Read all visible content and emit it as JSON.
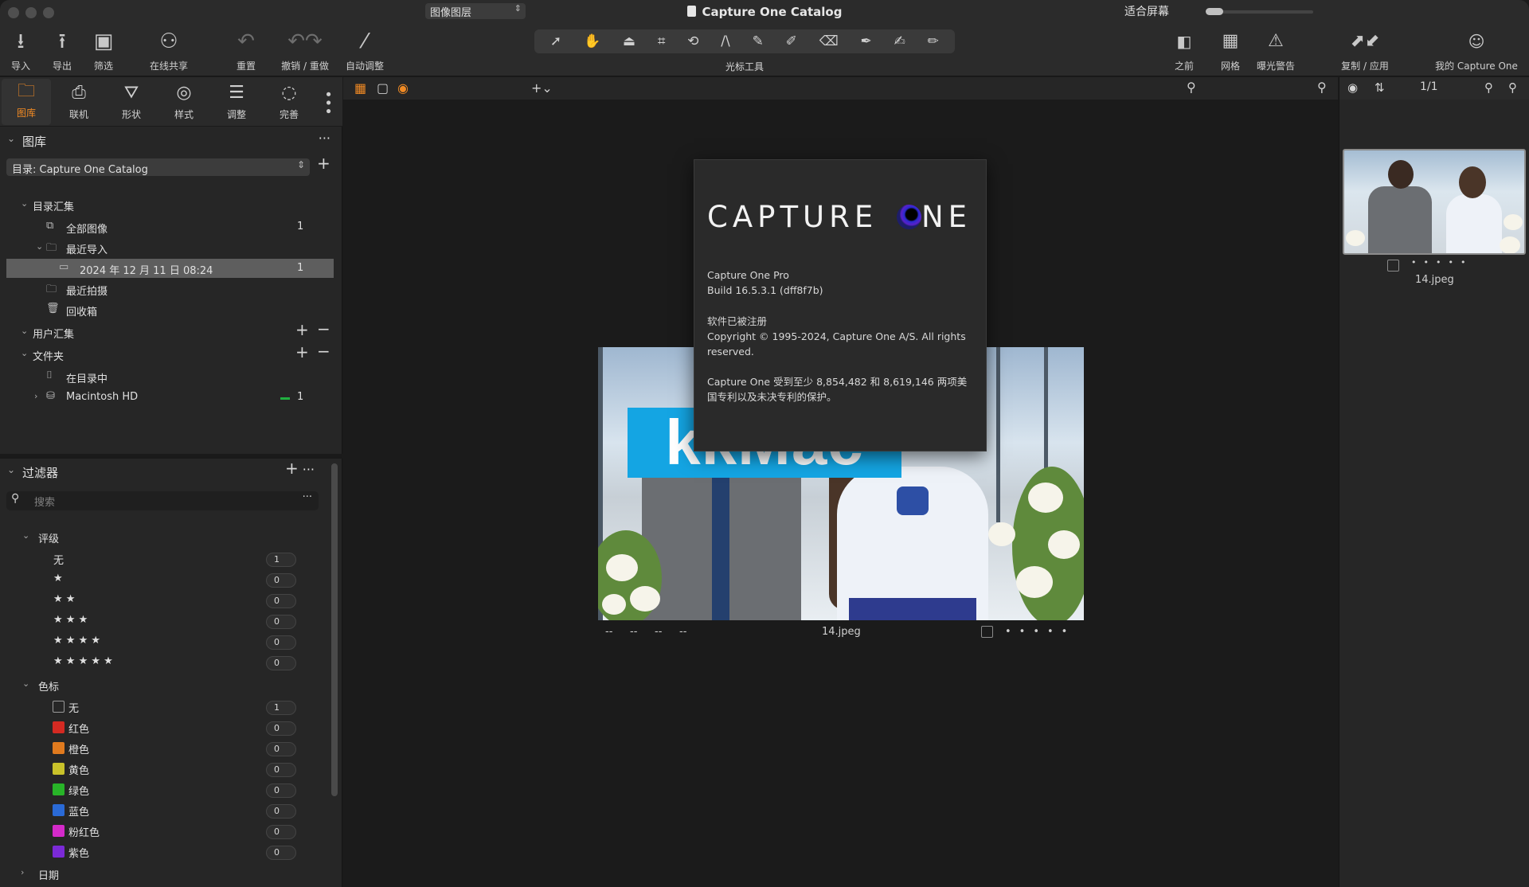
{
  "window": {
    "title": "Capture One Catalog"
  },
  "toolbar": {
    "import": "导入",
    "export": "导出",
    "filter": "筛选",
    "share": "在线共享",
    "reset": "重置",
    "undo_redo": "撤销 / 重做",
    "auto_adjust": "自动调整",
    "cursor_tools": "光标工具",
    "before": "之前",
    "grid": "网格",
    "exposure_warning": "曝光警告",
    "copy_apply": "复制 / 应用",
    "my_capture_one": "我的 Capture One"
  },
  "tabs": [
    "图库",
    "联机",
    "形状",
    "样式",
    "调整",
    "完善"
  ],
  "library": {
    "header": "图库",
    "catalog_select": "目录: Capture One Catalog",
    "catalog_collections": "目录汇集",
    "all_images": {
      "label": "全部图像",
      "count": "1"
    },
    "recent_imports": "最近导入",
    "import_item": {
      "label": "2024 年 12 月 11 日 08:24",
      "count": "1"
    },
    "recent_captures": "最近拍摄",
    "trash": "回收箱",
    "user_collections": "用户汇集",
    "folders": "文件夹",
    "in_catalog": "在目录中",
    "macintosh_hd": {
      "label": "Macintosh HD",
      "count": "1"
    }
  },
  "filters": {
    "header": "过滤器",
    "search_placeholder": "搜索",
    "rating_header": "评级",
    "ratings": [
      {
        "label": "无",
        "count": "1"
      },
      {
        "label": "★",
        "count": "0"
      },
      {
        "label": "★ ★",
        "count": "0"
      },
      {
        "label": "★ ★ ★",
        "count": "0"
      },
      {
        "label": "★ ★ ★ ★",
        "count": "0"
      },
      {
        "label": "★ ★ ★ ★ ★",
        "count": "0"
      }
    ],
    "color_header": "色标",
    "colors": [
      {
        "label": "无",
        "count": "1",
        "color": "transparent"
      },
      {
        "label": "红色",
        "count": "0",
        "color": "#d42a22"
      },
      {
        "label": "橙色",
        "count": "0",
        "color": "#e07a1e"
      },
      {
        "label": "黄色",
        "count": "0",
        "color": "#c9c22a"
      },
      {
        "label": "绿色",
        "count": "0",
        "color": "#28b428"
      },
      {
        "label": "蓝色",
        "count": "0",
        "color": "#2a6ad6"
      },
      {
        "label": "粉红色",
        "count": "0",
        "color": "#d42ac9"
      },
      {
        "label": "紫色",
        "count": "0",
        "color": "#7b2ad6"
      }
    ],
    "date_header": "日期"
  },
  "viewer": {
    "layer_select": "图像图层",
    "fit_screen": "适合屏幕",
    "caption_placeholders": [
      "--",
      "--",
      "--",
      "--"
    ],
    "filename": "14.jpeg",
    "watermark": "kkMac"
  },
  "about": {
    "logo_left": "CAPTURE",
    "logo_right": "NE",
    "product": "Capture One Pro",
    "build": "Build 16.5.3.1 (dff8f7b)",
    "registered": "软件已被注册",
    "copyright": "Copyright © 1995-2024, Capture One A/S. All rights reserved.",
    "patents": "Capture One 受到至少 8,854,482 和 8,619,146 两项美国专利以及未决专利的保护。"
  },
  "browser": {
    "counter": "1/1",
    "thumb_filename": "14.jpeg"
  }
}
